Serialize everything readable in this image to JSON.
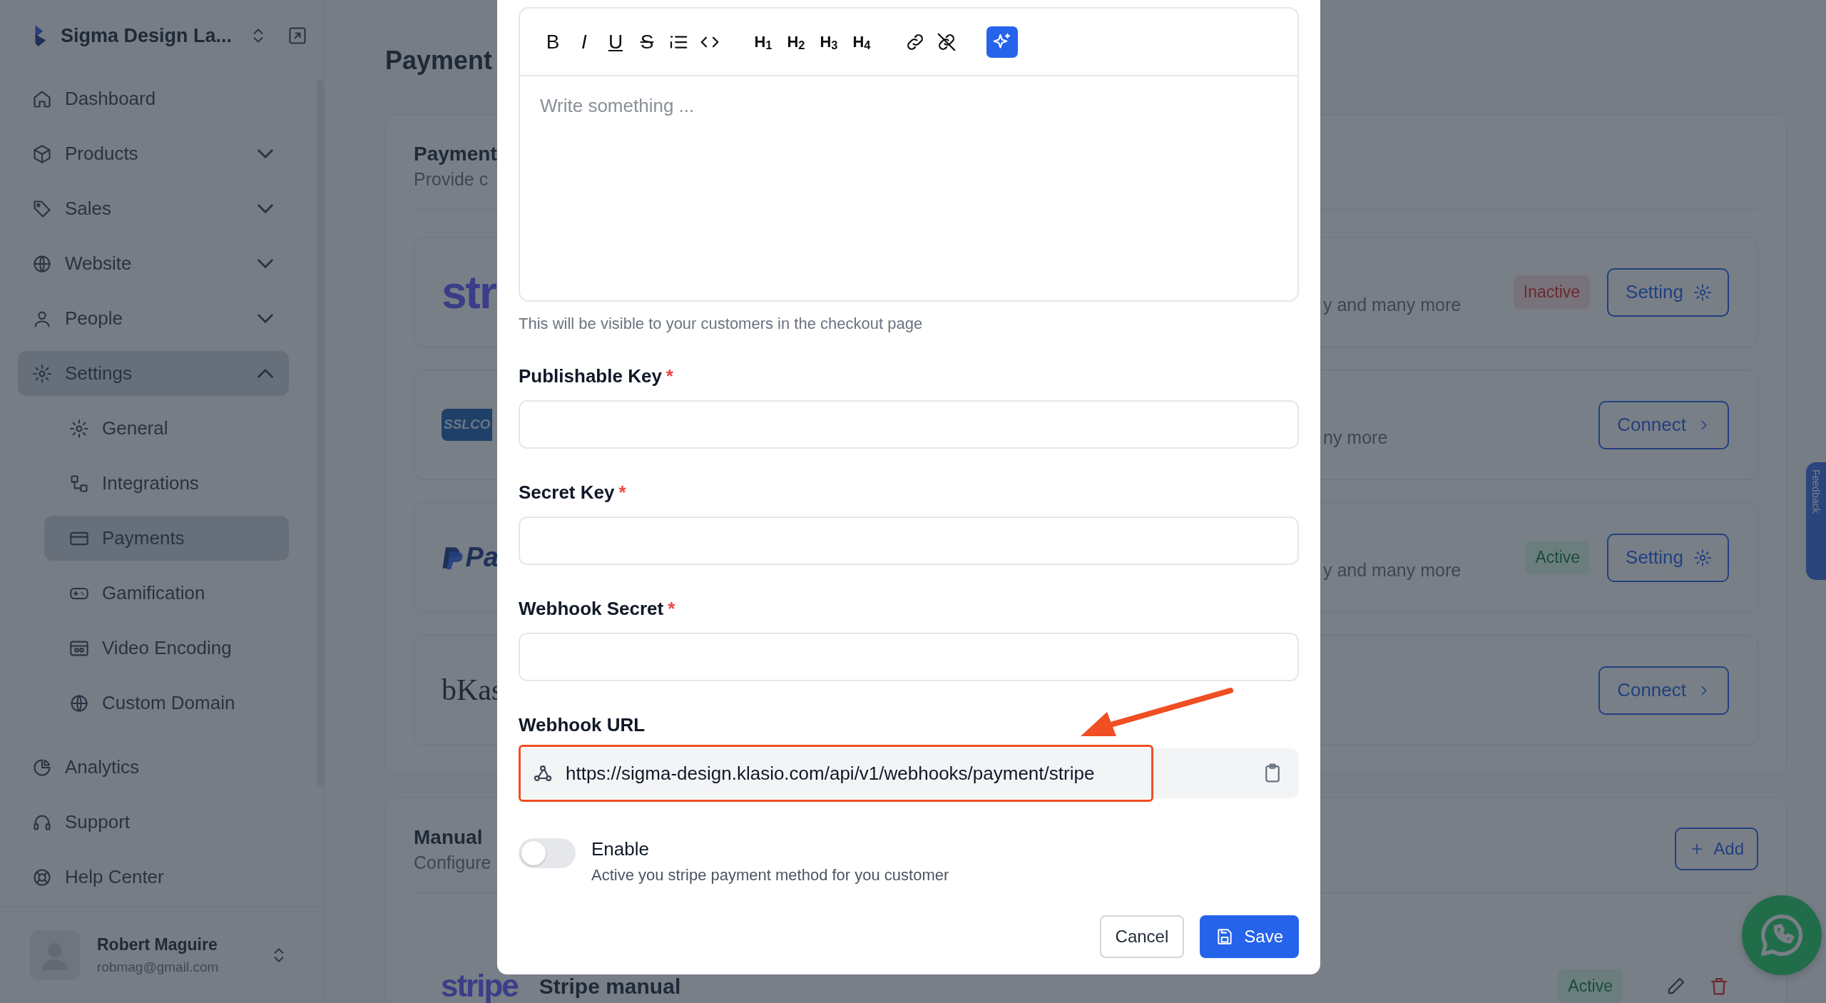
{
  "sidebar": {
    "workspace": "Sigma Design La...",
    "items": [
      {
        "label": "Dashboard",
        "kind": "link",
        "selected": false
      },
      {
        "label": "Products",
        "kind": "group",
        "selected": false,
        "expanded": false
      },
      {
        "label": "Sales",
        "kind": "group",
        "selected": false,
        "expanded": false
      },
      {
        "label": "Website",
        "kind": "group",
        "selected": false,
        "expanded": false
      },
      {
        "label": "People",
        "kind": "group",
        "selected": false,
        "expanded": false
      },
      {
        "label": "Settings",
        "kind": "group",
        "selected": true,
        "expanded": true,
        "children": [
          {
            "label": "General",
            "selected": false
          },
          {
            "label": "Integrations",
            "selected": false
          },
          {
            "label": "Payments",
            "selected": true
          },
          {
            "label": "Gamification",
            "selected": false
          },
          {
            "label": "Video Encoding",
            "selected": false
          },
          {
            "label": "Custom Domain",
            "selected": false
          }
        ]
      },
      {
        "label": "Analytics",
        "kind": "link",
        "selected": false
      },
      {
        "label": "Support",
        "kind": "link",
        "selected": false
      },
      {
        "label": "Help Center",
        "kind": "link",
        "selected": false
      }
    ],
    "user": {
      "name": "Robert Maguire",
      "email": "robmag@gmail.com"
    }
  },
  "page": {
    "title": "Payment",
    "gateway_section": {
      "title": "Payment",
      "subtitle": "Provide c",
      "gateways": [
        {
          "logo": "str",
          "kind": "stripe",
          "description": "y and many more",
          "status": {
            "text": "Inactive",
            "kind": "danger"
          },
          "action": {
            "label": "Setting",
            "kind": "setting"
          }
        },
        {
          "logo": "SSLCO",
          "kind": "sslcommerz",
          "description": "ny more",
          "action": {
            "label": "Connect",
            "kind": "connect"
          }
        },
        {
          "logo": "Pa",
          "kind": "paypal",
          "description": "y and many more",
          "status": {
            "text": "Active",
            "kind": "success"
          },
          "action": {
            "label": "Setting",
            "kind": "setting"
          }
        },
        {
          "logo": "bKas",
          "kind": "bkash",
          "action": {
            "label": "Connect",
            "kind": "connect"
          }
        }
      ]
    },
    "manual_section": {
      "title": "Manual",
      "subtitle": "Configure",
      "add_button": "Add",
      "methods": [
        {
          "logo": "stripe",
          "kind": "stripe",
          "name": "Stripe manual",
          "status": {
            "text": "Active",
            "kind": "success"
          }
        }
      ]
    }
  },
  "modal": {
    "editor": {
      "format_buttons": [
        {
          "label": "B",
          "kind": "bold"
        },
        {
          "label": "I",
          "kind": "italic"
        },
        {
          "label": "U",
          "kind": "underline"
        },
        {
          "label": "S",
          "kind": "strike"
        }
      ],
      "headings": [
        "H$_{1}$",
        "H$_{2}$",
        "H$_{3}$",
        "H$_{4}$"
      ],
      "placeholder": "Write something ...",
      "help": "This will be visible to your customers in the checkout page"
    },
    "fields": [
      {
        "label": "Publishable Key",
        "required_mark": "*"
      },
      {
        "label": "Secret Key",
        "required_mark": "*"
      },
      {
        "label": "Webhook Secret",
        "required_mark": "*"
      }
    ],
    "webhook_url": {
      "label": "Webhook URL",
      "value": "https://sigma-design.klasio.com/api/v1/webhooks/payment/stripe"
    },
    "toggle": {
      "label": "Enable",
      "description": "Active you stripe payment method for you customer",
      "on": false
    },
    "cancel": "Cancel",
    "save": "Save"
  },
  "feedback_tab": "Feedback"
}
